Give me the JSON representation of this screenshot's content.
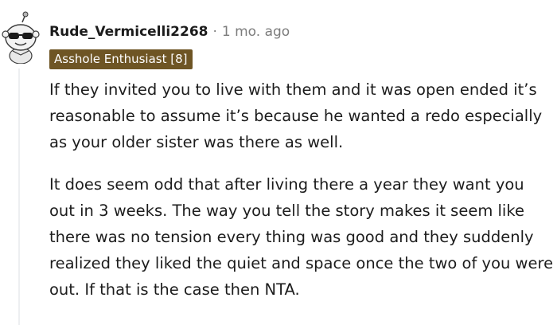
{
  "comment": {
    "username": "Rude_Vermicelli2268",
    "separator": "·",
    "timestamp": "1 mo. ago",
    "flair": "Asshole Enthusiast [8]",
    "avatar_icon": "snoo-avatar-icon",
    "paragraphs": [
      "If they invited you to live with them and it was open ended it’s reasonable to assume it’s because he wanted a redo especially as your older sister was there as well.",
      "It does seem odd that after living there a year they want you out in 3 weeks. The way you tell the story makes it seem like there was no tension every thing was good and they suddenly realized they liked the quiet and space once the two of you were out. If that is the case then NTA."
    ],
    "colors": {
      "text": "#1c1c1c",
      "meta": "#7c7c7c",
      "flair_bg": "#6e5524",
      "flair_text": "#ffffff",
      "thread_line": "#edeff1"
    }
  }
}
